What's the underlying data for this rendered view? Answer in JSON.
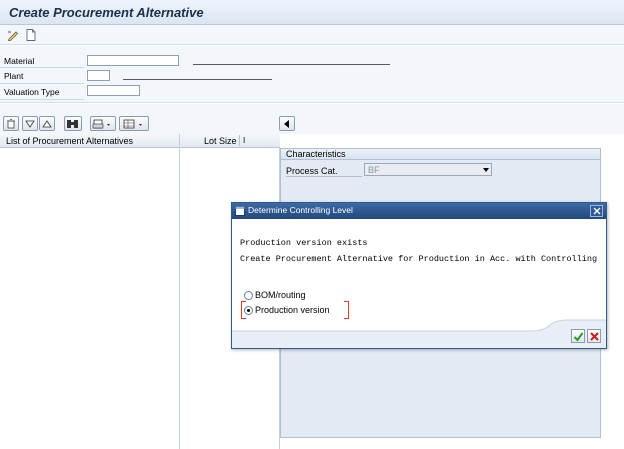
{
  "window": {
    "title": "Create Procurement Alternative"
  },
  "toolbar": {
    "icons": [
      "pencil-icon",
      "new-document-icon"
    ]
  },
  "header": {
    "material_label": "Material",
    "plant_label": "Plant",
    "valuation_type_label": "Valuation Type"
  },
  "list": {
    "col1": "List of Procurement Alternatives",
    "col2": "Lot Size",
    "col3": "I"
  },
  "characteristics": {
    "title": "Characteristics",
    "process_cat_label": "Process Cat.",
    "process_cat_value": "BF"
  },
  "dialog": {
    "title": "Determine Controlling Level",
    "line1": "Production version exists",
    "line2": "Create Procurement Alternative for Production in Acc. with Controlling",
    "option_bom": "BOM/routing",
    "option_prodver": "Production version",
    "selected": "Production version"
  },
  "colors": {
    "dialog_title_bg": "#2b5184",
    "panel_bg": "#e3eaf3",
    "confirm_green": "#2e9a2e",
    "cancel_red": "#c8201c"
  }
}
